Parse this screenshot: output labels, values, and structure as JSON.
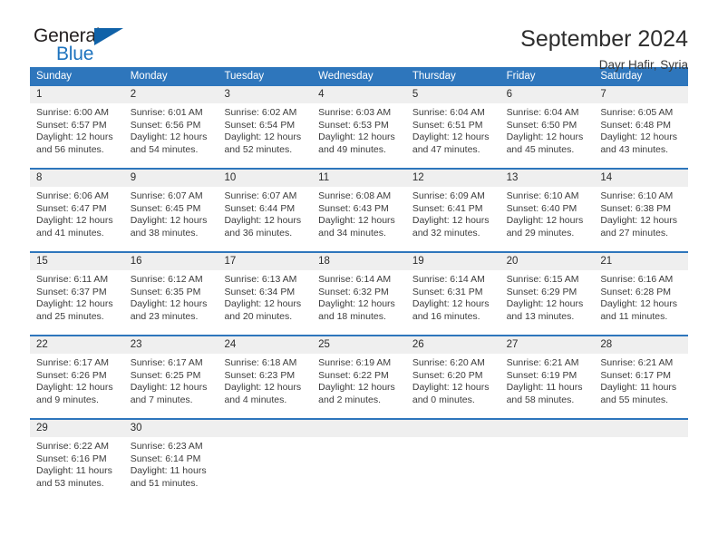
{
  "brand": {
    "name_top": "General",
    "name_bottom": "Blue",
    "flag_icon": "triangle-flag-icon",
    "color_blue": "#1e73be",
    "color_flag": "#1062a8"
  },
  "header": {
    "title": "September 2024",
    "location": "Dayr Hafir, Syria"
  },
  "theme": {
    "header_blue": "#2e76bc",
    "date_band_gray": "#efefef",
    "text": "#2b2b2b"
  },
  "calendar": {
    "weekdays": [
      "Sunday",
      "Monday",
      "Tuesday",
      "Wednesday",
      "Thursday",
      "Friday",
      "Saturday"
    ],
    "weeks": [
      [
        {
          "day": "1",
          "sunrise": "Sunrise: 6:00 AM",
          "sunset": "Sunset: 6:57 PM",
          "daylight1": "Daylight: 12 hours",
          "daylight2": "and 56 minutes."
        },
        {
          "day": "2",
          "sunrise": "Sunrise: 6:01 AM",
          "sunset": "Sunset: 6:56 PM",
          "daylight1": "Daylight: 12 hours",
          "daylight2": "and 54 minutes."
        },
        {
          "day": "3",
          "sunrise": "Sunrise: 6:02 AM",
          "sunset": "Sunset: 6:54 PM",
          "daylight1": "Daylight: 12 hours",
          "daylight2": "and 52 minutes."
        },
        {
          "day": "4",
          "sunrise": "Sunrise: 6:03 AM",
          "sunset": "Sunset: 6:53 PM",
          "daylight1": "Daylight: 12 hours",
          "daylight2": "and 49 minutes."
        },
        {
          "day": "5",
          "sunrise": "Sunrise: 6:04 AM",
          "sunset": "Sunset: 6:51 PM",
          "daylight1": "Daylight: 12 hours",
          "daylight2": "and 47 minutes."
        },
        {
          "day": "6",
          "sunrise": "Sunrise: 6:04 AM",
          "sunset": "Sunset: 6:50 PM",
          "daylight1": "Daylight: 12 hours",
          "daylight2": "and 45 minutes."
        },
        {
          "day": "7",
          "sunrise": "Sunrise: 6:05 AM",
          "sunset": "Sunset: 6:48 PM",
          "daylight1": "Daylight: 12 hours",
          "daylight2": "and 43 minutes."
        }
      ],
      [
        {
          "day": "8",
          "sunrise": "Sunrise: 6:06 AM",
          "sunset": "Sunset: 6:47 PM",
          "daylight1": "Daylight: 12 hours",
          "daylight2": "and 41 minutes."
        },
        {
          "day": "9",
          "sunrise": "Sunrise: 6:07 AM",
          "sunset": "Sunset: 6:45 PM",
          "daylight1": "Daylight: 12 hours",
          "daylight2": "and 38 minutes."
        },
        {
          "day": "10",
          "sunrise": "Sunrise: 6:07 AM",
          "sunset": "Sunset: 6:44 PM",
          "daylight1": "Daylight: 12 hours",
          "daylight2": "and 36 minutes."
        },
        {
          "day": "11",
          "sunrise": "Sunrise: 6:08 AM",
          "sunset": "Sunset: 6:43 PM",
          "daylight1": "Daylight: 12 hours",
          "daylight2": "and 34 minutes."
        },
        {
          "day": "12",
          "sunrise": "Sunrise: 6:09 AM",
          "sunset": "Sunset: 6:41 PM",
          "daylight1": "Daylight: 12 hours",
          "daylight2": "and 32 minutes."
        },
        {
          "day": "13",
          "sunrise": "Sunrise: 6:10 AM",
          "sunset": "Sunset: 6:40 PM",
          "daylight1": "Daylight: 12 hours",
          "daylight2": "and 29 minutes."
        },
        {
          "day": "14",
          "sunrise": "Sunrise: 6:10 AM",
          "sunset": "Sunset: 6:38 PM",
          "daylight1": "Daylight: 12 hours",
          "daylight2": "and 27 minutes."
        }
      ],
      [
        {
          "day": "15",
          "sunrise": "Sunrise: 6:11 AM",
          "sunset": "Sunset: 6:37 PM",
          "daylight1": "Daylight: 12 hours",
          "daylight2": "and 25 minutes."
        },
        {
          "day": "16",
          "sunrise": "Sunrise: 6:12 AM",
          "sunset": "Sunset: 6:35 PM",
          "daylight1": "Daylight: 12 hours",
          "daylight2": "and 23 minutes."
        },
        {
          "day": "17",
          "sunrise": "Sunrise: 6:13 AM",
          "sunset": "Sunset: 6:34 PM",
          "daylight1": "Daylight: 12 hours",
          "daylight2": "and 20 minutes."
        },
        {
          "day": "18",
          "sunrise": "Sunrise: 6:14 AM",
          "sunset": "Sunset: 6:32 PM",
          "daylight1": "Daylight: 12 hours",
          "daylight2": "and 18 minutes."
        },
        {
          "day": "19",
          "sunrise": "Sunrise: 6:14 AM",
          "sunset": "Sunset: 6:31 PM",
          "daylight1": "Daylight: 12 hours",
          "daylight2": "and 16 minutes."
        },
        {
          "day": "20",
          "sunrise": "Sunrise: 6:15 AM",
          "sunset": "Sunset: 6:29 PM",
          "daylight1": "Daylight: 12 hours",
          "daylight2": "and 13 minutes."
        },
        {
          "day": "21",
          "sunrise": "Sunrise: 6:16 AM",
          "sunset": "Sunset: 6:28 PM",
          "daylight1": "Daylight: 12 hours",
          "daylight2": "and 11 minutes."
        }
      ],
      [
        {
          "day": "22",
          "sunrise": "Sunrise: 6:17 AM",
          "sunset": "Sunset: 6:26 PM",
          "daylight1": "Daylight: 12 hours",
          "daylight2": "and 9 minutes."
        },
        {
          "day": "23",
          "sunrise": "Sunrise: 6:17 AM",
          "sunset": "Sunset: 6:25 PM",
          "daylight1": "Daylight: 12 hours",
          "daylight2": "and 7 minutes."
        },
        {
          "day": "24",
          "sunrise": "Sunrise: 6:18 AM",
          "sunset": "Sunset: 6:23 PM",
          "daylight1": "Daylight: 12 hours",
          "daylight2": "and 4 minutes."
        },
        {
          "day": "25",
          "sunrise": "Sunrise: 6:19 AM",
          "sunset": "Sunset: 6:22 PM",
          "daylight1": "Daylight: 12 hours",
          "daylight2": "and 2 minutes."
        },
        {
          "day": "26",
          "sunrise": "Sunrise: 6:20 AM",
          "sunset": "Sunset: 6:20 PM",
          "daylight1": "Daylight: 12 hours",
          "daylight2": "and 0 minutes."
        },
        {
          "day": "27",
          "sunrise": "Sunrise: 6:21 AM",
          "sunset": "Sunset: 6:19 PM",
          "daylight1": "Daylight: 11 hours",
          "daylight2": "and 58 minutes."
        },
        {
          "day": "28",
          "sunrise": "Sunrise: 6:21 AM",
          "sunset": "Sunset: 6:17 PM",
          "daylight1": "Daylight: 11 hours",
          "daylight2": "and 55 minutes."
        }
      ],
      [
        {
          "day": "29",
          "sunrise": "Sunrise: 6:22 AM",
          "sunset": "Sunset: 6:16 PM",
          "daylight1": "Daylight: 11 hours",
          "daylight2": "and 53 minutes."
        },
        {
          "day": "30",
          "sunrise": "Sunrise: 6:23 AM",
          "sunset": "Sunset: 6:14 PM",
          "daylight1": "Daylight: 11 hours",
          "daylight2": "and 51 minutes."
        },
        {
          "day": "",
          "sunrise": "",
          "sunset": "",
          "daylight1": "",
          "daylight2": ""
        },
        {
          "day": "",
          "sunrise": "",
          "sunset": "",
          "daylight1": "",
          "daylight2": ""
        },
        {
          "day": "",
          "sunrise": "",
          "sunset": "",
          "daylight1": "",
          "daylight2": ""
        },
        {
          "day": "",
          "sunrise": "",
          "sunset": "",
          "daylight1": "",
          "daylight2": ""
        },
        {
          "day": "",
          "sunrise": "",
          "sunset": "",
          "daylight1": "",
          "daylight2": ""
        }
      ]
    ]
  }
}
